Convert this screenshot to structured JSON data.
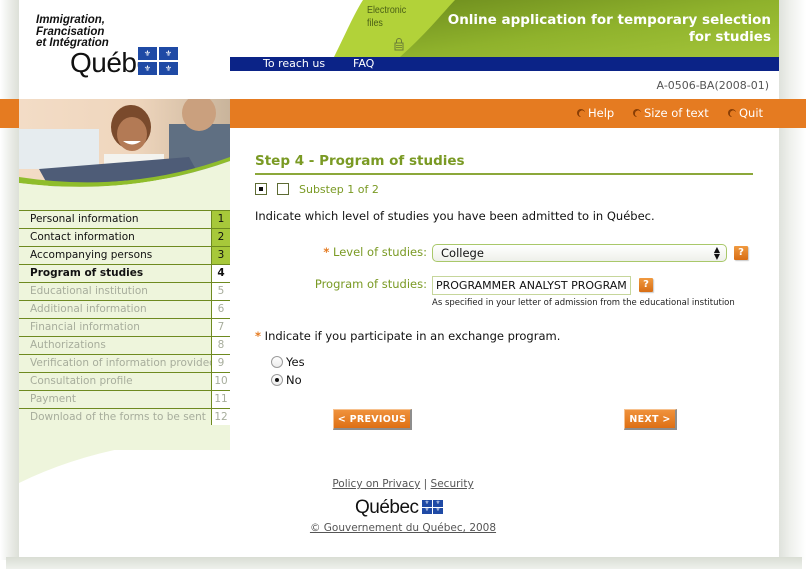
{
  "header": {
    "ministry_lines": [
      "Immigration,",
      "Francisation",
      "et Intégration"
    ],
    "quebec_wordmark": "Québec",
    "flag_glyph": "⚜",
    "electronic_files_line1": "Electronic",
    "electronic_files_line2": "files",
    "app_title_line1": "Online application for temporary selection",
    "app_title_line2": "for studies",
    "nav_links": [
      "To reach us",
      "FAQ"
    ],
    "form_code": "A-0506-BA(2008-01)"
  },
  "utility_links": [
    "Help",
    "Size of text",
    "Quit"
  ],
  "sidebar": {
    "items": [
      {
        "label": "Personal information",
        "number": "1",
        "state": "done"
      },
      {
        "label": "Contact information",
        "number": "2",
        "state": "done"
      },
      {
        "label": "Accompanying persons",
        "number": "3",
        "state": "done"
      },
      {
        "label": "Program of studies",
        "number": "4",
        "state": "current"
      },
      {
        "label": "Educational institution",
        "number": "5",
        "state": "todo"
      },
      {
        "label": "Additional information",
        "number": "6",
        "state": "todo"
      },
      {
        "label": "Financial information",
        "number": "7",
        "state": "todo"
      },
      {
        "label": "Authorizations",
        "number": "8",
        "state": "todo"
      },
      {
        "label": "Verification of information provided",
        "number": "9",
        "state": "todo"
      },
      {
        "label": "Consultation profile",
        "number": "10",
        "state": "todo"
      },
      {
        "label": "Payment",
        "number": "11",
        "state": "todo"
      },
      {
        "label": "Download of the forms to be sent",
        "number": "12",
        "state": "todo"
      }
    ]
  },
  "main": {
    "step_title": "Step 4 - Program of studies",
    "substep_label": "Substep 1 of 2",
    "intro": "Indicate which level of studies you have been admitted to in Québec.",
    "required_mark": "*",
    "level_label": "Level of studies:",
    "level_value": "College",
    "program_label": "Program of studies:",
    "program_value": "PROGRAMMER ANALYST PROGRAM",
    "program_hint": "As specified in your letter of admission from the educational institution",
    "help_glyph": "?",
    "exchange_question": "Indicate if you participate in an exchange program.",
    "exchange_options": [
      {
        "label": "Yes",
        "checked": false
      },
      {
        "label": "No",
        "checked": true
      }
    ],
    "previous_label": "< PREVIOUS",
    "next_label": "NEXT >"
  },
  "footer": {
    "privacy_link": "Policy on Privacy",
    "separator": "|",
    "security_link": "Security",
    "quebec_wordmark": "Québec",
    "copyright": "© Gouvernement du Québec, 2008"
  },
  "colors": {
    "brand_green": "#a7c83a",
    "heading_green": "#7a9a24",
    "nav_blue": "#0b2387",
    "accent_orange": "#e57b21"
  }
}
